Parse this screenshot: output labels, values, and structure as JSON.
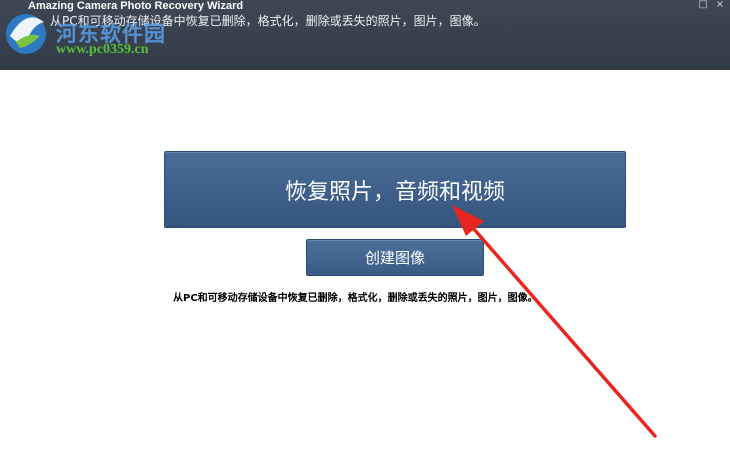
{
  "header": {
    "app_title": "Amazing Camera Photo Recovery Wizard",
    "subtitle": "从PC和可移动存储设备中恢复已删除，格式化，删除或丢失的照片，图片，图像。",
    "watermark_name": "河东软件园",
    "watermark_url": "www.pc0359.cn",
    "window_controls": [
      "□",
      "×"
    ]
  },
  "main": {
    "primary_button_label": "恢复照片，音频和视频",
    "secondary_button_label": "创建图像",
    "description": "从PC和可移动存储设备中恢复已删除，格式化，删除或丢失的照片，图片，图像。"
  },
  "colors": {
    "header_bg": "#37414d",
    "button_blue": "#3d5f89",
    "annotation_arrow": "#e8261f",
    "watermark_green": "#57c13a"
  },
  "icons": [
    "app-logo-icon",
    "red-arrow-annotation"
  ]
}
